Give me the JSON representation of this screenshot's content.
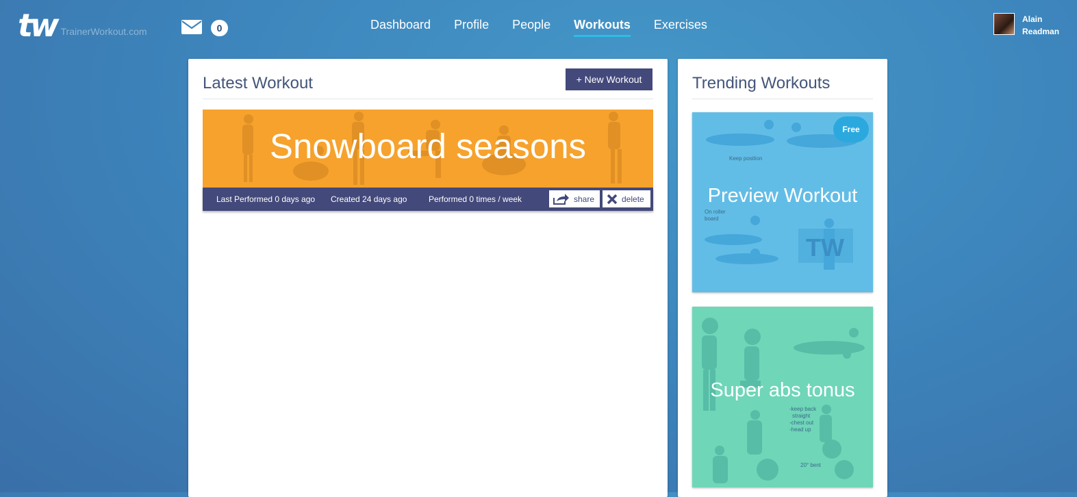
{
  "header": {
    "logo_mark": "tw",
    "logo_text": "TrainerWorkout.com",
    "message_count": "0",
    "nav": [
      "Dashboard",
      "Profile",
      "People",
      "Workouts",
      "Exercises"
    ],
    "active_nav": "Workouts",
    "user_first": "Alain",
    "user_last": "Readman"
  },
  "latest": {
    "title": "Latest Workout",
    "new_button": "+ New Workout",
    "workout_name": "Snowboard seasons",
    "last_performed": "Last Performed 0 days ago",
    "created": "Created 24 days ago",
    "performed": "Performed 0 times / week",
    "share_label": "share",
    "delete_label": "delete"
  },
  "trending": {
    "title": "Trending Workouts",
    "items": [
      {
        "name": "Preview Workout",
        "badge": "Free",
        "notes": [
          "Keep position",
          "On roller",
          "board"
        ]
      },
      {
        "name": "Super abs tonus",
        "notes": [
          "-keep back",
          "straight",
          "-chest out",
          "-head up",
          "20° bent"
        ]
      }
    ]
  },
  "colors": {
    "accent": "#43497a",
    "nav_underline": "#2ebde6",
    "banner": "#f6a22d",
    "tile_blue": "#62bde6",
    "tile_green": "#6fd6b8"
  },
  "icons": [
    "envelope-icon",
    "share-icon",
    "close-icon"
  ]
}
